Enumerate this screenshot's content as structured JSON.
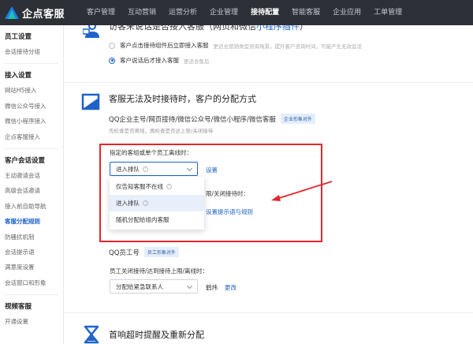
{
  "app": {
    "name": "企点客服"
  },
  "topnav": [
    {
      "label": "客户管理"
    },
    {
      "label": "互动营销"
    },
    {
      "label": "运营分析"
    },
    {
      "label": "企业管理"
    },
    {
      "label": "接待配置"
    },
    {
      "label": "智能客服"
    },
    {
      "label": "企业应用"
    },
    {
      "label": "工单管理"
    }
  ],
  "topnav_active": "接待配置",
  "sidebar": {
    "groups": [
      {
        "title": "员工设置",
        "items": [
          "会话接待分组"
        ]
      },
      {
        "title": "接入设置",
        "items": [
          "网站H5接入",
          "微信公众号接入",
          "微信小程序接入",
          "企点客服接入"
        ]
      },
      {
        "title": "客户会话设置",
        "items": [
          "主动邀请会话",
          "高级会话邀请",
          "接入前自助导航",
          "客服分配规则",
          "防骚扰机制",
          "会话提示语",
          "满意度设置",
          "会话窗口和形象"
        ]
      },
      {
        "title": "视频客服",
        "items": [
          "开通设置"
        ]
      }
    ],
    "active_item": "客服分配规则"
  },
  "section_top": {
    "title_prefix": "访客未说话是否接入客服（网页和微信",
    "title_highlight": "小程序插件",
    "title_suffix": "）",
    "options": [
      {
        "label": "客户点击接待组件后立即接入客服",
        "hint": "更适合营销类型咨询场景，提升客户咨询时间，可能产生无效会话",
        "checked": false
      },
      {
        "label": "客户说话后才接入客服",
        "hint": "更适合售后",
        "checked": true
      }
    ]
  },
  "section_offline": {
    "title": "客服无法及时接待时，客户的分配方式",
    "qq_block": {
      "title": "QQ企业主号/网页接待/微信公众号/微信小程序/微信客服",
      "tag": "企业形象对外",
      "desc": "先检查是否离线，再检查是否达上限/关闭接待",
      "field_label": "指定的客组或单个员工离线时：",
      "select_value": "进入排队",
      "settings_link": "设置",
      "behind_label": "限/关闭接待时：",
      "prompt_link": "设置提示语与规则",
      "dropdown_options": [
        {
          "label": "仅告知客服不在线",
          "has_help": true,
          "selected": false
        },
        {
          "label": "进入排队",
          "has_help": true,
          "selected": true
        },
        {
          "label": "随机分配给组内客服",
          "has_help": false,
          "selected": false
        }
      ]
    },
    "qq_employee": {
      "title": "QQ员工号",
      "tag": "员工形象对外",
      "field_label": "员工关闭接待/达到接待上限/离线时：",
      "select_value": "分配给紧急联系人",
      "contact_name": "鹤炜",
      "change_link": "更改"
    }
  },
  "section_timeout": {
    "title": "首响超时提醒及重新分配"
  },
  "colors": {
    "accent": "#1d63c9",
    "topbar": "#2d3036",
    "annotation": "#e3262b"
  }
}
